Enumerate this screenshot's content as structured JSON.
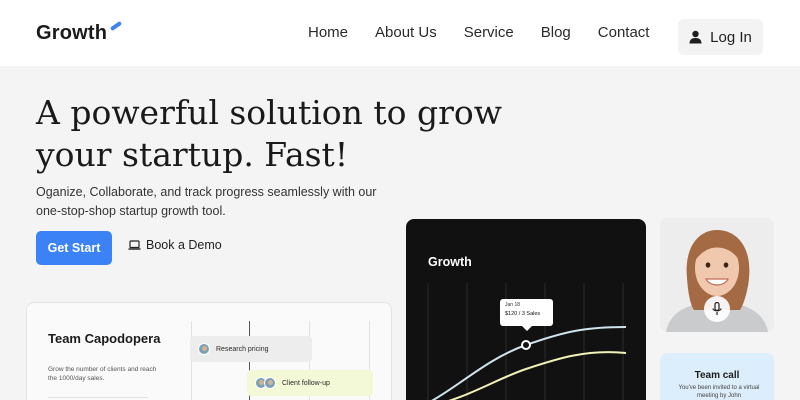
{
  "brand": {
    "name": "Growth",
    "accent": "#3b82f6"
  },
  "nav": {
    "links": [
      "Home",
      "About Us",
      "Service",
      "Blog",
      "Contact"
    ],
    "login_label": "Log In",
    "login_icon": "user-icon"
  },
  "hero": {
    "title": "A powerful solution to grow your startup. Fast!",
    "subtitle": "Oganize, Collaborate, and track progress seamlessly with our one-stop-shop startup growth tool.",
    "primary_cta": "Get Start",
    "secondary_cta": "Book a Demo",
    "secondary_icon": "laptop-icon"
  },
  "team_card": {
    "title": "Team Capodopera",
    "description": "Grow the number of clients and reach the 1000/day sales.",
    "tasks": [
      {
        "label": "Research pricing",
        "color": "#ededed"
      },
      {
        "label": "Client follow-up",
        "color": "#f3f8d6"
      }
    ]
  },
  "growth_card": {
    "title": "Growth",
    "tooltip_date": "Jan 18",
    "tooltip_value": "$120 / 3 Sales",
    "line_colors": [
      "#cfe3ef",
      "#f2f1b8"
    ]
  },
  "profile": {
    "mic_icon": "microphone-icon"
  },
  "call_card": {
    "title": "Team call",
    "description": "You've been invited to a virtual meeting by John"
  }
}
